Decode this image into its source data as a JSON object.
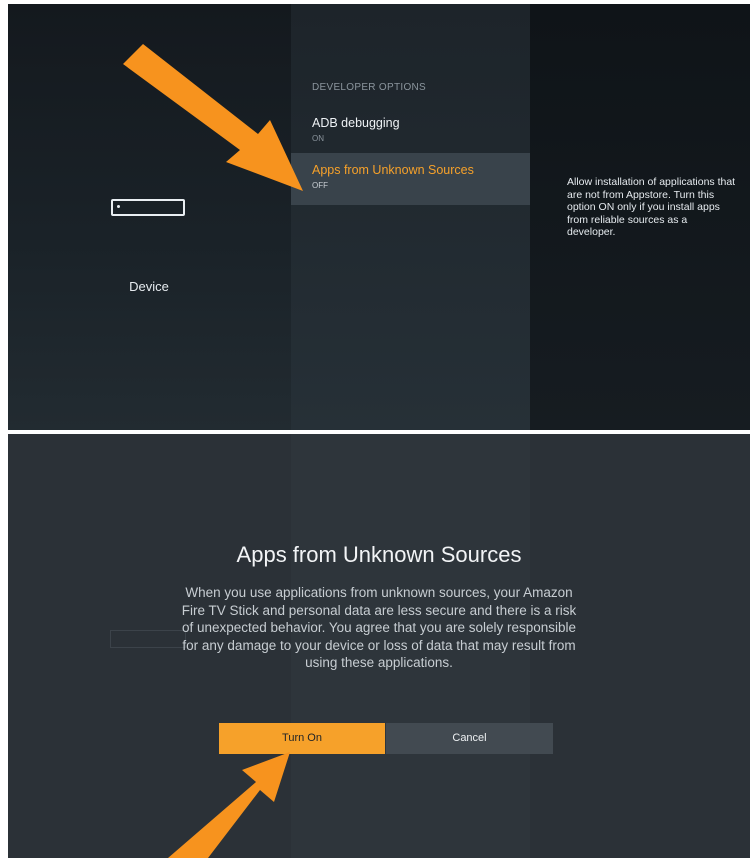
{
  "top_screen": {
    "device_label": "Device",
    "section_heading": "DEVELOPER OPTIONS",
    "menu_items": [
      {
        "label": "ADB debugging",
        "status": "ON",
        "selected": false
      },
      {
        "label": "Apps from Unknown Sources",
        "status": "OFF",
        "selected": true
      }
    ],
    "help_text": "Allow installation of applications that are not from Appstore. Turn this option ON only if you install apps from reliable sources as a developer."
  },
  "dialog": {
    "title": "Apps from Unknown Sources",
    "body": "When you use applications from unknown sources, your Amazon Fire TV Stick and personal data are less secure and there is a risk of unexpected behavior. You agree that you are solely responsible for any damage to your device or loss of data that may result from using these applications.",
    "turn_on_label": "Turn On",
    "cancel_label": "Cancel"
  },
  "colors": {
    "accent": "#f6a12a",
    "arrow": "#f7931e",
    "background_dark": "#14191e",
    "dialog_background": "#2b3137"
  },
  "icons": [
    "device-icon",
    "arrow-pointer-icon"
  ]
}
